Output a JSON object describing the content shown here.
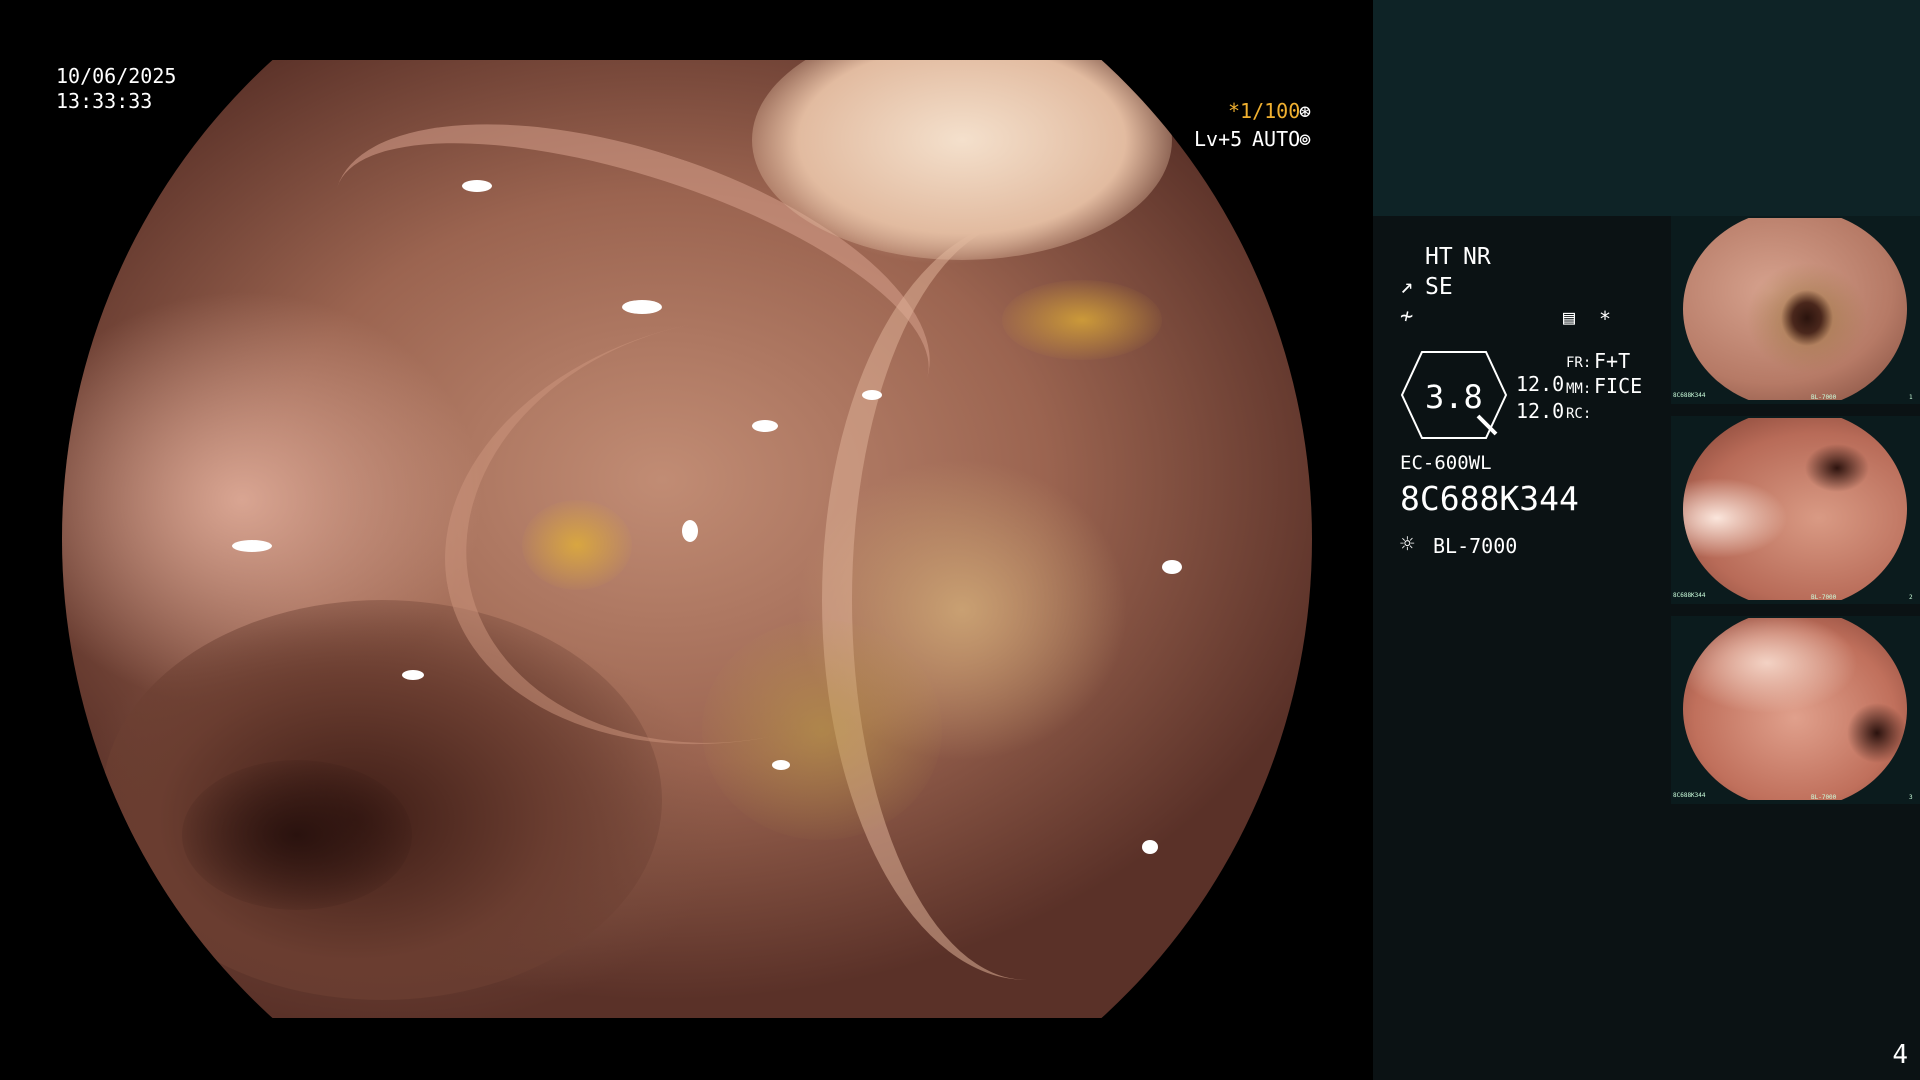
{
  "overlay": {
    "date": "10/06/2025",
    "time": "13:33:33",
    "shutter": "*1/100",
    "level": "Lv+5",
    "iris": "AUTO"
  },
  "panel": {
    "ht": "HT",
    "nr": "NR",
    "se": "SE",
    "gauge_value": "3.8",
    "val_1": "12.0",
    "val_2": "12.0",
    "fr_label": "FR:",
    "fr_value": "F+T",
    "mm_label": "MM:",
    "mm_value": "FICE",
    "rc_label": "RC:",
    "scope_model": "EC-600WL",
    "serial": "8C688K344",
    "light_source": "BL-7000",
    "page_number": "4"
  },
  "thumbnails": [
    {
      "index": "1",
      "serial": "8C688K344",
      "light": "BL-7000"
    },
    {
      "index": "2",
      "serial": "8C688K344",
      "light": "BL-7000"
    },
    {
      "index": "3",
      "serial": "8C688K344",
      "light": "BL-7000"
    }
  ],
  "colors": {
    "accent": "#f0b030",
    "panel_bg": "#0b1214",
    "panel_top_bg": "#0e2326"
  }
}
